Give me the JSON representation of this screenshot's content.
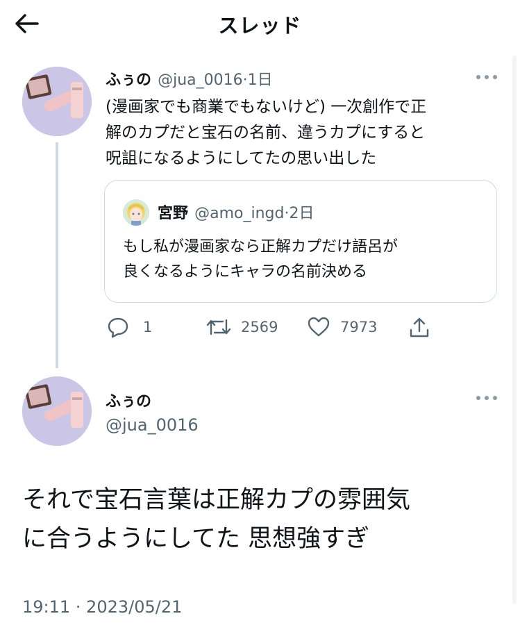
{
  "header": {
    "title": "スレッド"
  },
  "tweet1": {
    "name": "ふぅの",
    "handle": "@jua_0016",
    "separator": "·",
    "time": "1日",
    "text_lines": [
      "(漫画家でも商業でもないけど) 一次創作で正",
      "解のカプだと宝石の名前、違うカプにすると",
      "呪詛になるようにしてたの思い出した"
    ],
    "quote": {
      "name": "宮野",
      "handle": "@amo_ingd",
      "separator": "·",
      "time": "2日",
      "text_lines": [
        "もし私が漫画家なら正解カプだけ語呂が",
        "良くなるようにキャラの名前決める"
      ]
    },
    "actions": {
      "reply_count": "1",
      "retweet_count": "2569",
      "like_count": "7973"
    }
  },
  "tweet2": {
    "name": "ふぅの",
    "handle": "@jua_0016",
    "text_lines": [
      "それで宝石言葉は正解カプの雰囲気",
      "に合うようにしてた 思想強すぎ"
    ],
    "timestamp": "19:11 · 2023/05/21"
  },
  "icons": {
    "back": "arrow-left-icon",
    "more": "more-dots-icon",
    "reply": "reply-bubble-icon",
    "retweet": "retweet-icon",
    "like": "heart-icon",
    "share": "share-icon"
  },
  "colors": {
    "text": "#0f1419",
    "secondary": "#536471",
    "border": "#cfd9de"
  }
}
